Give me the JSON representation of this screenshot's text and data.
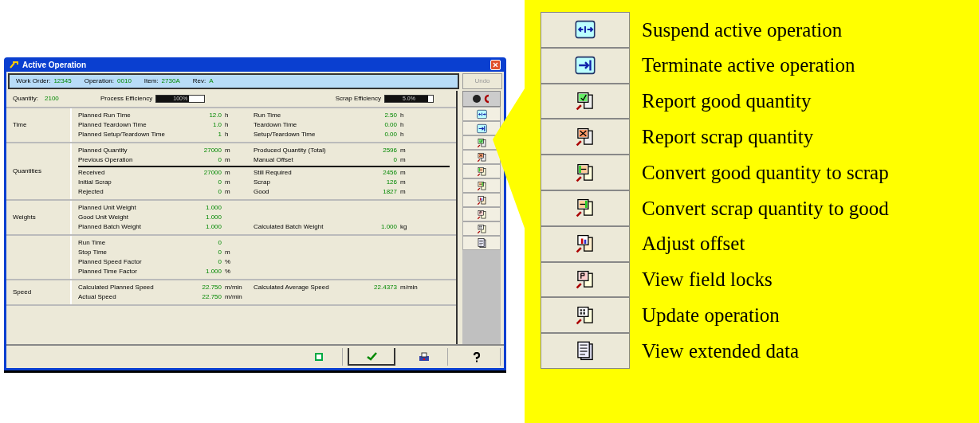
{
  "window": {
    "title": "Active Operation",
    "header": [
      {
        "label": "Work Order:",
        "value": "12345"
      },
      {
        "label": "Operation:",
        "value": "0010"
      },
      {
        "label": "Item:",
        "value": "2730A"
      },
      {
        "label": "Rev:",
        "value": "A"
      }
    ],
    "header_button": "Undo",
    "summary": {
      "quantity_label": "Quantity:",
      "quantity_value": "2100",
      "bars": [
        {
          "label": "Process Efficiency",
          "reading": "100%",
          "level": 0.6
        },
        {
          "label": "Scrap Efficiency",
          "reading": "5.0%",
          "level": 0.9
        }
      ]
    },
    "sections": [
      {
        "label": "Time",
        "rows": [
          {
            "label": "Planned Run Time",
            "value": "12.0",
            "unit": "h",
            "right_label": "Run Time",
            "right_value": "2.50",
            "right_unit": "h"
          },
          {
            "label": "Planned Teardown Time",
            "value": "1.0",
            "unit": "h",
            "right_label": "Teardown Time",
            "right_value": "0.00",
            "right_unit": "h"
          },
          {
            "label": "Planned Setup/Teardown Time",
            "value": "1",
            "unit": "h",
            "right_label": "Setup/Teardown Time",
            "right_value": "0.00",
            "right_unit": "h"
          }
        ]
      },
      {
        "label": "Quantities",
        "rows": [
          {
            "label": "Planned Quantity",
            "value": "27000",
            "unit": "m",
            "right_label": "Produced Quantity (Total)",
            "right_value": "2596",
            "right_unit": "m",
            "rule_above": false
          },
          {
            "label": "Previous Operation",
            "value": "0",
            "unit": "m",
            "right_label": "Manual Offset",
            "right_value": "0",
            "right_unit": "m",
            "rule_above": false
          },
          {
            "label": "Received",
            "value": "27000",
            "unit": "m",
            "right_label": "Still Required",
            "right_value": "2456",
            "right_unit": "m",
            "rule_above": true
          },
          {
            "label": "Initial Scrap",
            "value": "0",
            "unit": "m",
            "right_label": "Scrap",
            "right_value": "126",
            "right_unit": "m",
            "rule_above": false
          },
          {
            "label": "Rejected",
            "value": "0",
            "unit": "m",
            "right_label": "Good",
            "right_value": "1827",
            "right_unit": "m",
            "rule_above": false
          }
        ]
      },
      {
        "label": "Weights",
        "rows": [
          {
            "label": "Planned Unit Weight",
            "value": "1.000"
          },
          {
            "label": "Good Unit Weight",
            "value": "1.000"
          },
          {
            "label": "Planned Batch Weight",
            "value": "1.000",
            "right_label": "Calculated Batch Weight",
            "right_value": "1.000",
            "right_unit": "kg"
          }
        ]
      },
      {
        "rows": [
          {
            "label": "Run Time",
            "value": "0"
          },
          {
            "label": "Stop Time",
            "value": "0",
            "unit": "m"
          },
          {
            "label": "Planned Speed Factor",
            "value": "0",
            "unit": "%"
          },
          {
            "label": "Planned Time Factor",
            "value": "1.000",
            "unit": "%"
          }
        ]
      },
      {
        "label": "Speed",
        "rows": [
          {
            "label": "Calculated Planned Speed",
            "value": "22.750",
            "unit": "m/min",
            "right_label": "Calculated Average Speed",
            "right_value": "22.4373",
            "right_unit": "m/min"
          },
          {
            "label": "Actual Speed",
            "value": "22.750",
            "unit": "m/min"
          }
        ]
      }
    ]
  },
  "legend": [
    {
      "label": "Suspend active operation"
    },
    {
      "label": "Terminate active operation"
    },
    {
      "label": "Report good quantity"
    },
    {
      "label": "Report scrap quantity"
    },
    {
      "label": "Convert good quantity to scrap"
    },
    {
      "label": "Convert scrap quantity to good"
    },
    {
      "label": "Adjust offset"
    },
    {
      "label": "View field locks"
    },
    {
      "label": "Update operation"
    },
    {
      "label": "View extended data"
    }
  ]
}
